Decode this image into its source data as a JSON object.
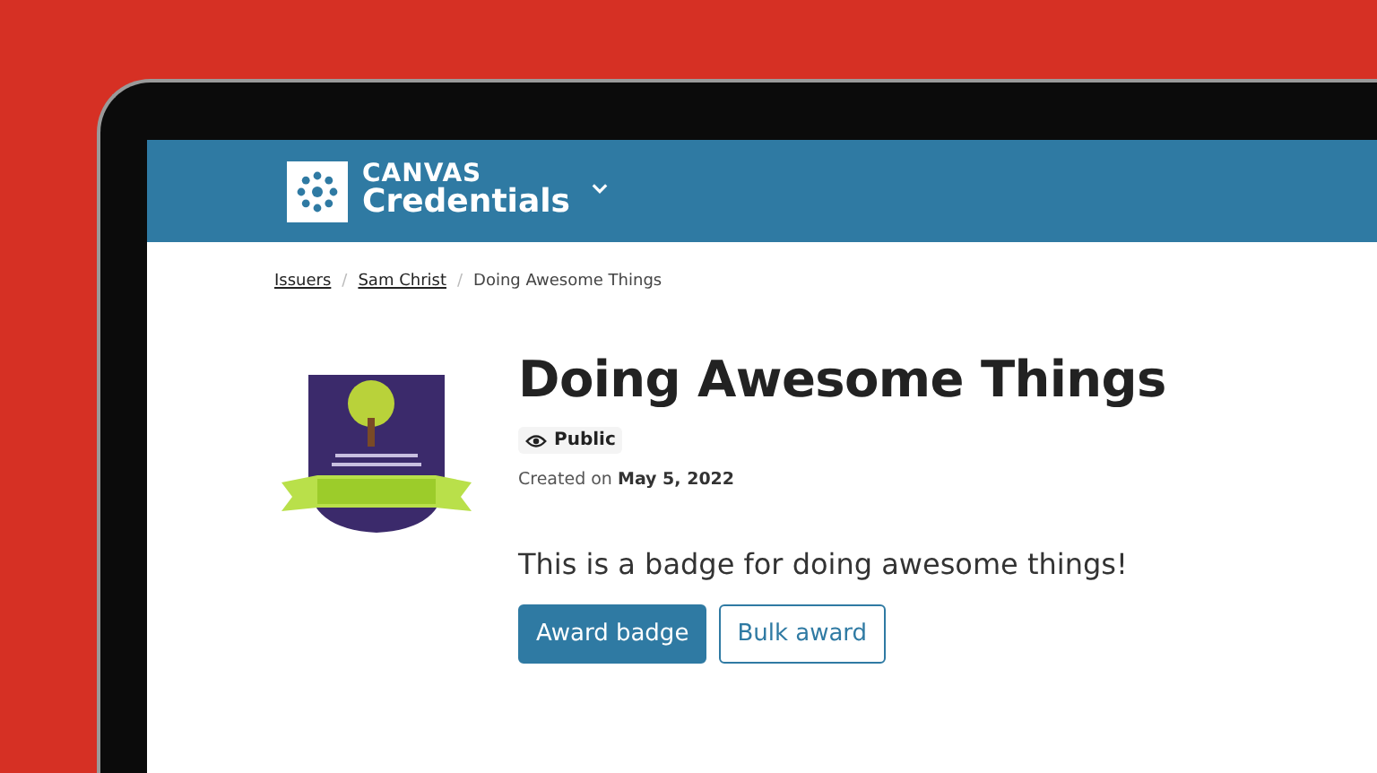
{
  "header": {
    "logo_line_1": "CANVAS",
    "logo_line_2": "Credentials"
  },
  "breadcrumb_separator": "/",
  "breadcrumbs": [
    {
      "label": "Issuers",
      "link": true
    },
    {
      "label": "Sam Christ",
      "link": true
    },
    {
      "label": "Doing Awesome Things",
      "link": false
    }
  ],
  "badge": {
    "title": "Doing Awesome Things",
    "visibility": "Public",
    "created": "Created on **May 5, 2022**",
    "description": "This is a badge for doing awesome things!"
  },
  "buttons": [
    {
      "label": "Award badge",
      "kind": "primary"
    },
    {
      "label": "Bulk award",
      "kind": "secondary"
    }
  ]
}
